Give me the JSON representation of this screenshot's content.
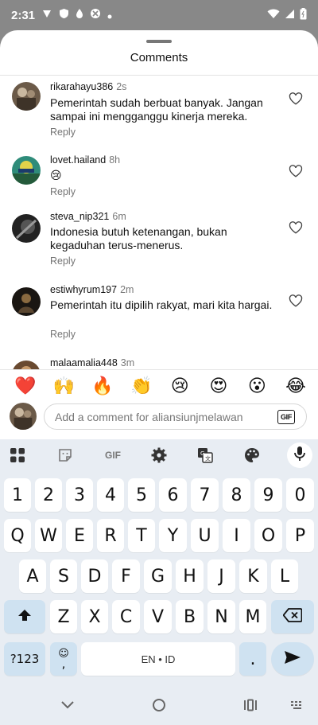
{
  "status_bar": {
    "time": "2:31"
  },
  "sheet": {
    "title": "Comments"
  },
  "comments": [
    {
      "user": "rikarahayu386",
      "time": "2s",
      "text": "Pemerintah sudah berbuat banyak. Jangan sampai ini mengganggu kinerja mereka.",
      "reply": "Reply"
    },
    {
      "user": "lovet.hailand",
      "time": "8h",
      "text": "😢",
      "reply": "Reply"
    },
    {
      "user": "steva_nip321",
      "time": "6m",
      "text": "Indonesia butuh ketenangan, bukan kegaduhan terus-menerus.",
      "reply": "Reply"
    },
    {
      "user": "estiwhyrum197",
      "time": "2m",
      "text": "Pemerintah itu dipilih rakyat, mari kita hargai.",
      "reply": "Reply"
    },
    {
      "user": "malaamalia448",
      "time": "3m",
      "text": "",
      "reply": ""
    }
  ],
  "emoji_bar": [
    "❤️",
    "🙌",
    "🔥",
    "👏",
    "😢",
    "😍",
    "😮",
    "😂"
  ],
  "composer": {
    "placeholder": "Add a comment for aliansiunjmelawan",
    "gif_label": "GIF"
  },
  "keyboard": {
    "toolbar_gif": "GIF",
    "row_numbers": [
      "1",
      "2",
      "3",
      "4",
      "5",
      "6",
      "7",
      "8",
      "9",
      "0"
    ],
    "row1": [
      "Q",
      "W",
      "E",
      "R",
      "T",
      "Y",
      "U",
      "I",
      "O",
      "P"
    ],
    "row2": [
      "A",
      "S",
      "D",
      "F",
      "G",
      "H",
      "J",
      "K",
      "L"
    ],
    "row3": [
      "Z",
      "X",
      "C",
      "V",
      "B",
      "N",
      "M"
    ],
    "symbols_key": "?123",
    "emoji_key": "☺",
    "comma_key": ",",
    "space_label": "EN • ID",
    "period_key": "."
  }
}
